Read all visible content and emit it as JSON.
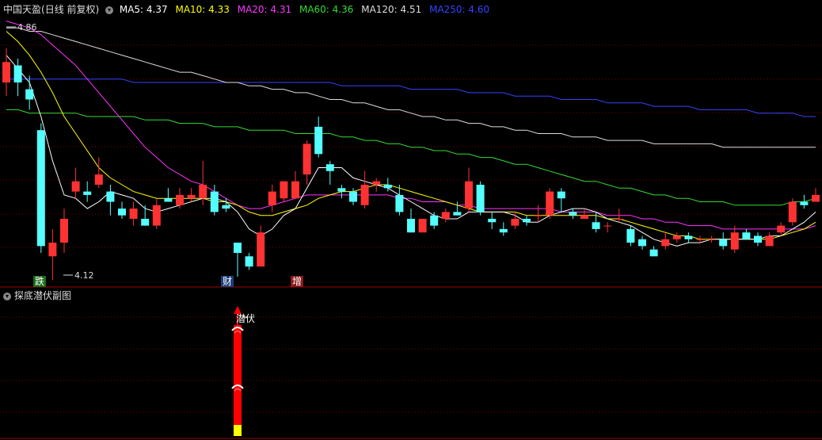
{
  "header": {
    "stock_name": "中国天盈",
    "mode": "(日线 前复权)",
    "ma_items": [
      {
        "label": "MA5: 4.37",
        "color": "#ffffff"
      },
      {
        "label": "MA10: 4.33",
        "color": "#ffff00"
      },
      {
        "label": "MA20: 4.31",
        "color": "#ff33ff"
      },
      {
        "label": "MA60: 4.36",
        "color": "#33dd33"
      },
      {
        "label": "MA120: 4.51",
        "color": "#dddddd"
      },
      {
        "label": "MA250: 4.60",
        "color": "#3344ff"
      }
    ]
  },
  "price_marks": {
    "high_label": "4.86",
    "low_label": "4.12"
  },
  "event_tags": [
    {
      "label": "跌",
      "color": "#33cc33",
      "bar_index": 3
    },
    {
      "label": "财",
      "color": "#33aaff",
      "bar_index": 20
    },
    {
      "label": "增",
      "color": "#ff4444",
      "bar_index": 26
    }
  ],
  "sub_chart": {
    "title": "探底潜伏副图",
    "signal_label": "潜伏",
    "signal_bar_index": 20
  },
  "colors": {
    "up": "#ff3232",
    "down": "#54ffff",
    "grid": "#7a0000",
    "border": "#a00000"
  },
  "chart_data": {
    "type": "candlestick",
    "candles": [
      [
        4.7,
        4.76,
        4.8,
        4.66
      ],
      [
        4.75,
        4.7,
        4.77,
        4.66
      ],
      [
        4.68,
        4.65,
        4.72,
        4.62
      ],
      [
        4.56,
        4.22,
        4.58,
        4.2
      ],
      [
        4.19,
        4.23,
        4.27,
        4.12
      ],
      [
        4.23,
        4.3,
        4.33,
        4.2
      ],
      [
        4.38,
        4.41,
        4.45,
        4.36
      ],
      [
        4.38,
        4.37,
        4.41,
        4.35
      ],
      [
        4.4,
        4.43,
        4.48,
        4.39
      ],
      [
        4.38,
        4.35,
        4.4,
        4.31
      ],
      [
        4.33,
        4.31,
        4.35,
        4.3
      ],
      [
        4.3,
        4.33,
        4.35,
        4.28
      ],
      [
        4.3,
        4.28,
        4.34,
        4.28
      ],
      [
        4.28,
        4.34,
        4.36,
        4.27
      ],
      [
        4.36,
        4.35,
        4.39,
        4.35
      ],
      [
        4.34,
        4.37,
        4.39,
        4.33
      ],
      [
        4.36,
        4.37,
        4.39,
        4.35
      ],
      [
        4.36,
        4.4,
        4.47,
        4.34
      ],
      [
        4.38,
        4.32,
        4.4,
        4.31
      ],
      [
        4.34,
        4.33,
        4.36,
        4.32
      ],
      [
        4.23,
        4.2,
        4.23,
        4.13
      ],
      [
        4.19,
        4.16,
        4.2,
        4.15
      ],
      [
        4.16,
        4.26,
        4.28,
        4.16
      ],
      [
        4.34,
        4.38,
        4.4,
        4.32
      ],
      [
        4.36,
        4.41,
        4.41,
        4.35
      ],
      [
        4.36,
        4.41,
        4.44,
        4.36
      ],
      [
        4.43,
        4.52,
        4.53,
        4.4
      ],
      [
        4.57,
        4.49,
        4.6,
        4.48
      ],
      [
        4.46,
        4.44,
        4.47,
        4.4
      ],
      [
        4.39,
        4.38,
        4.4,
        4.36
      ],
      [
        4.38,
        4.35,
        4.39,
        4.34
      ],
      [
        4.34,
        4.4,
        4.44,
        4.33
      ],
      [
        4.4,
        4.41,
        4.42,
        4.38
      ],
      [
        4.4,
        4.39,
        4.42,
        4.38
      ],
      [
        4.37,
        4.32,
        4.4,
        4.31
      ],
      [
        4.3,
        4.26,
        4.33,
        4.26
      ],
      [
        4.26,
        4.3,
        4.3,
        4.26
      ],
      [
        4.31,
        4.28,
        4.32,
        4.27
      ],
      [
        4.3,
        4.32,
        4.33,
        4.29
      ],
      [
        4.32,
        4.31,
        4.35,
        4.31
      ],
      [
        4.33,
        4.41,
        4.45,
        4.32
      ],
      [
        4.4,
        4.32,
        4.41,
        4.31
      ],
      [
        4.3,
        4.29,
        4.32,
        4.27
      ],
      [
        4.27,
        4.26,
        4.29,
        4.25
      ],
      [
        4.28,
        4.3,
        4.32,
        4.27
      ],
      [
        4.3,
        4.29,
        4.31,
        4.28
      ],
      [
        4.31,
        4.31,
        4.34,
        4.29
      ],
      [
        4.31,
        4.38,
        4.39,
        4.3
      ],
      [
        4.38,
        4.36,
        4.39,
        4.32
      ],
      [
        4.32,
        4.31,
        4.33,
        4.3
      ],
      [
        4.3,
        4.31,
        4.33,
        4.3
      ],
      [
        4.29,
        4.27,
        4.32,
        4.26
      ],
      [
        4.28,
        4.28,
        4.29,
        4.26
      ],
      [
        4.3,
        4.3,
        4.33,
        4.29
      ],
      [
        4.27,
        4.23,
        4.28,
        4.22
      ],
      [
        4.24,
        4.22,
        4.25,
        4.21
      ],
      [
        4.21,
        4.19,
        4.22,
        4.19
      ],
      [
        4.22,
        4.24,
        4.26,
        4.21
      ],
      [
        4.24,
        4.25,
        4.26,
        4.23
      ],
      [
        4.25,
        4.24,
        4.26,
        4.23
      ],
      [
        4.24,
        4.24,
        4.25,
        4.23
      ],
      [
        4.24,
        4.24,
        4.25,
        4.23
      ],
      [
        4.24,
        4.22,
        4.26,
        4.21
      ],
      [
        4.21,
        4.26,
        4.28,
        4.2
      ],
      [
        4.26,
        4.24,
        4.27,
        4.24
      ],
      [
        4.25,
        4.23,
        4.26,
        4.22
      ],
      [
        4.22,
        4.25,
        4.26,
        4.22
      ],
      [
        4.26,
        4.28,
        4.29,
        4.25
      ],
      [
        4.29,
        4.35,
        4.36,
        4.28
      ],
      [
        4.35,
        4.34,
        4.37,
        4.33
      ],
      [
        4.35,
        4.37,
        4.39,
        4.35
      ]
    ],
    "ma5": [
      4.78,
      4.74,
      4.7,
      4.6,
      4.47,
      4.37,
      4.36,
      4.33,
      4.35,
      4.38,
      4.37,
      4.36,
      4.33,
      4.32,
      4.33,
      4.34,
      4.35,
      4.36,
      4.36,
      4.35,
      4.32,
      4.27,
      4.25,
      4.27,
      4.31,
      4.33,
      4.39,
      4.45,
      4.45,
      4.45,
      4.42,
      4.41,
      4.4,
      4.39,
      4.37,
      4.35,
      4.33,
      4.31,
      4.3,
      4.3,
      4.32,
      4.32,
      4.32,
      4.32,
      4.31,
      4.29,
      4.29,
      4.31,
      4.32,
      4.33,
      4.33,
      4.32,
      4.3,
      4.29,
      4.28,
      4.26,
      4.24,
      4.23,
      4.22,
      4.23,
      4.23,
      4.24,
      4.24,
      4.24,
      4.24,
      4.24,
      4.25,
      4.25,
      4.27,
      4.29,
      4.32
    ],
    "ma10": [
      4.85,
      4.82,
      4.78,
      4.73,
      4.67,
      4.6,
      4.55,
      4.5,
      4.45,
      4.42,
      4.4,
      4.38,
      4.37,
      4.36,
      4.36,
      4.36,
      4.36,
      4.36,
      4.35,
      4.35,
      4.34,
      4.32,
      4.31,
      4.31,
      4.32,
      4.33,
      4.34,
      4.36,
      4.37,
      4.38,
      4.38,
      4.39,
      4.4,
      4.4,
      4.39,
      4.38,
      4.37,
      4.36,
      4.35,
      4.34,
      4.33,
      4.32,
      4.32,
      4.32,
      4.32,
      4.31,
      4.31,
      4.31,
      4.31,
      4.31,
      4.31,
      4.31,
      4.3,
      4.3,
      4.29,
      4.28,
      4.27,
      4.26,
      4.25,
      4.25,
      4.24,
      4.24,
      4.24,
      4.24,
      4.24,
      4.24,
      4.24,
      4.25,
      4.26,
      4.27,
      4.29
    ],
    "ma20": [
      4.88,
      4.87,
      4.86,
      4.84,
      4.81,
      4.78,
      4.75,
      4.71,
      4.67,
      4.63,
      4.59,
      4.55,
      4.51,
      4.48,
      4.45,
      4.43,
      4.41,
      4.4,
      4.38,
      4.36,
      4.34,
      4.33,
      4.33,
      4.34,
      4.35,
      4.36,
      4.37,
      4.37,
      4.37,
      4.37,
      4.37,
      4.37,
      4.37,
      4.37,
      4.36,
      4.36,
      4.35,
      4.35,
      4.35,
      4.34,
      4.34,
      4.33,
      4.33,
      4.33,
      4.33,
      4.33,
      4.33,
      4.33,
      4.32,
      4.32,
      4.32,
      4.32,
      4.31,
      4.31,
      4.31,
      4.3,
      4.3,
      4.29,
      4.29,
      4.28,
      4.28,
      4.28,
      4.27,
      4.27,
      4.27,
      4.27,
      4.27,
      4.27,
      4.27,
      4.27,
      4.28
    ],
    "ma60": [
      4.62,
      4.62,
      4.61,
      4.61,
      4.61,
      4.61,
      4.61,
      4.6,
      4.6,
      4.6,
      4.6,
      4.6,
      4.59,
      4.59,
      4.59,
      4.58,
      4.58,
      4.58,
      4.57,
      4.57,
      4.57,
      4.56,
      4.56,
      4.56,
      4.56,
      4.55,
      4.55,
      4.55,
      4.55,
      4.54,
      4.54,
      4.53,
      4.53,
      4.52,
      4.52,
      4.51,
      4.51,
      4.5,
      4.5,
      4.49,
      4.49,
      4.48,
      4.48,
      4.47,
      4.46,
      4.46,
      4.45,
      4.44,
      4.43,
      4.42,
      4.41,
      4.41,
      4.4,
      4.39,
      4.39,
      4.38,
      4.37,
      4.37,
      4.36,
      4.36,
      4.35,
      4.35,
      4.35,
      4.34,
      4.34,
      4.34,
      4.34,
      4.34,
      4.35,
      4.35,
      4.36
    ],
    "ma120": [
      4.86,
      4.86,
      4.85,
      4.85,
      4.84,
      4.83,
      4.82,
      4.81,
      4.8,
      4.79,
      4.78,
      4.77,
      4.76,
      4.75,
      4.74,
      4.73,
      4.73,
      4.72,
      4.71,
      4.7,
      4.7,
      4.69,
      4.69,
      4.68,
      4.68,
      4.67,
      4.67,
      4.66,
      4.65,
      4.65,
      4.64,
      4.64,
      4.63,
      4.62,
      4.62,
      4.61,
      4.6,
      4.6,
      4.59,
      4.59,
      4.58,
      4.58,
      4.57,
      4.57,
      4.56,
      4.56,
      4.55,
      4.55,
      4.55,
      4.54,
      4.54,
      4.54,
      4.53,
      4.53,
      4.53,
      4.53,
      4.52,
      4.52,
      4.52,
      4.52,
      4.52,
      4.52,
      4.51,
      4.51,
      4.51,
      4.51,
      4.51,
      4.51,
      4.51,
      4.51,
      4.51
    ],
    "ma250": [
      4.71,
      4.71,
      4.71,
      4.71,
      4.71,
      4.71,
      4.71,
      4.71,
      4.71,
      4.71,
      4.71,
      4.7,
      4.7,
      4.7,
      4.7,
      4.7,
      4.7,
      4.7,
      4.7,
      4.7,
      4.7,
      4.7,
      4.7,
      4.7,
      4.7,
      4.7,
      4.7,
      4.7,
      4.7,
      4.69,
      4.69,
      4.69,
      4.69,
      4.69,
      4.69,
      4.68,
      4.68,
      4.68,
      4.68,
      4.68,
      4.67,
      4.67,
      4.67,
      4.67,
      4.66,
      4.66,
      4.66,
      4.66,
      4.65,
      4.65,
      4.65,
      4.65,
      4.64,
      4.64,
      4.64,
      4.64,
      4.63,
      4.63,
      4.63,
      4.63,
      4.62,
      4.62,
      4.62,
      4.62,
      4.62,
      4.61,
      4.61,
      4.61,
      4.61,
      4.6,
      4.6
    ],
    "ylim": [
      4.1,
      4.9
    ]
  }
}
